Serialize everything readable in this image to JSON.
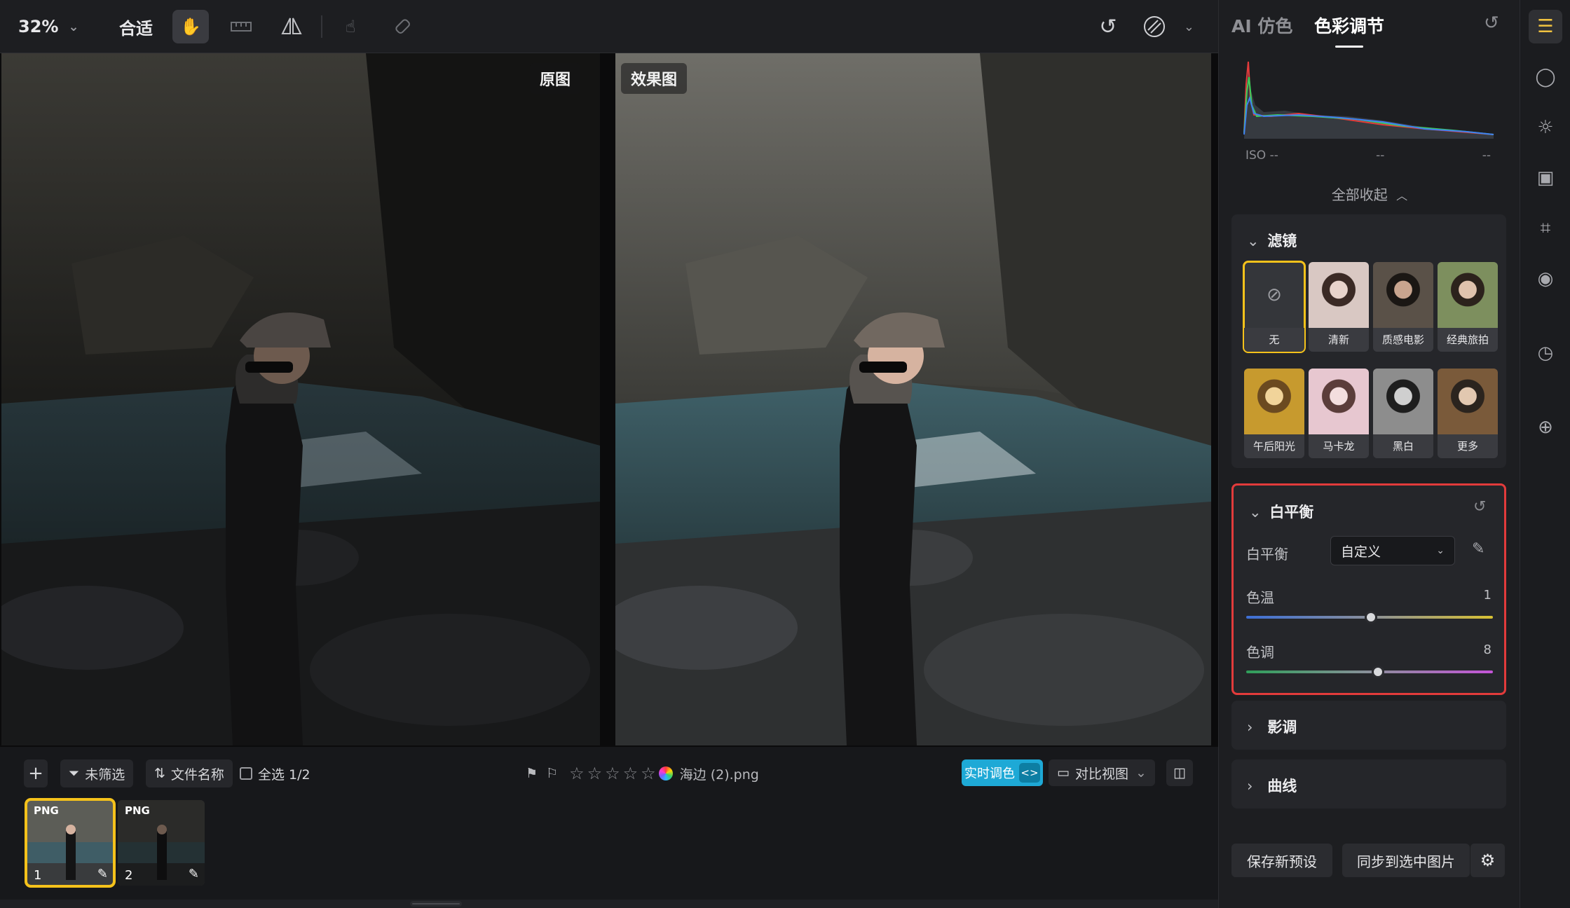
{
  "toolbar": {
    "zoom": "32%",
    "fit_label": "合适",
    "tools": [
      "hand-icon",
      "ruler-icon",
      "flip-icon",
      "touch-icon",
      "eraser-icon"
    ],
    "right_tools": [
      "undo-icon",
      "mask-icon"
    ]
  },
  "canvas": {
    "before_label": "原图",
    "after_label": "效果图"
  },
  "filmbar": {
    "add_icon": "plus-icon",
    "filter_label": "未筛选",
    "sort_label": "文件名称",
    "select_all_label": "全选 1/2",
    "filename": "海边 (2).png",
    "star_count": 5,
    "rating": 0,
    "realtime_label": "实时调色",
    "compare_label": "对比视图"
  },
  "thumbnails": [
    {
      "type": "PNG",
      "index": "1",
      "selected": true
    },
    {
      "type": "PNG",
      "index": "2",
      "selected": false
    }
  ],
  "panel": {
    "tab_ai": "AI 仿色",
    "tab_color": "色彩调节",
    "iso_label": "ISO --",
    "iso_mid": "--",
    "iso_right": "--",
    "collapse_all": "全部收起",
    "filters": {
      "title": "滤镜",
      "items": [
        "无",
        "清新",
        "质感电影",
        "经典旅拍",
        "午后阳光",
        "马卡龙",
        "黑白",
        "更多"
      ],
      "selected": "无"
    },
    "white_balance": {
      "title": "白平衡",
      "mode_label": "白平衡",
      "mode_value": "自定义",
      "temp_label": "色温",
      "temp_value": "1",
      "temp_fraction": 0.505,
      "tint_label": "色调",
      "tint_value": "8",
      "tint_fraction": 0.535
    },
    "tone_title": "影调",
    "curve_title": "曲线",
    "save_preset": "保存新预设",
    "sync_label": "同步到选中图片"
  },
  "colors": {
    "accent_yellow": "#f5c21b",
    "highlight_red": "#e23b3b",
    "realtime_blue": "#1ea9d6"
  }
}
